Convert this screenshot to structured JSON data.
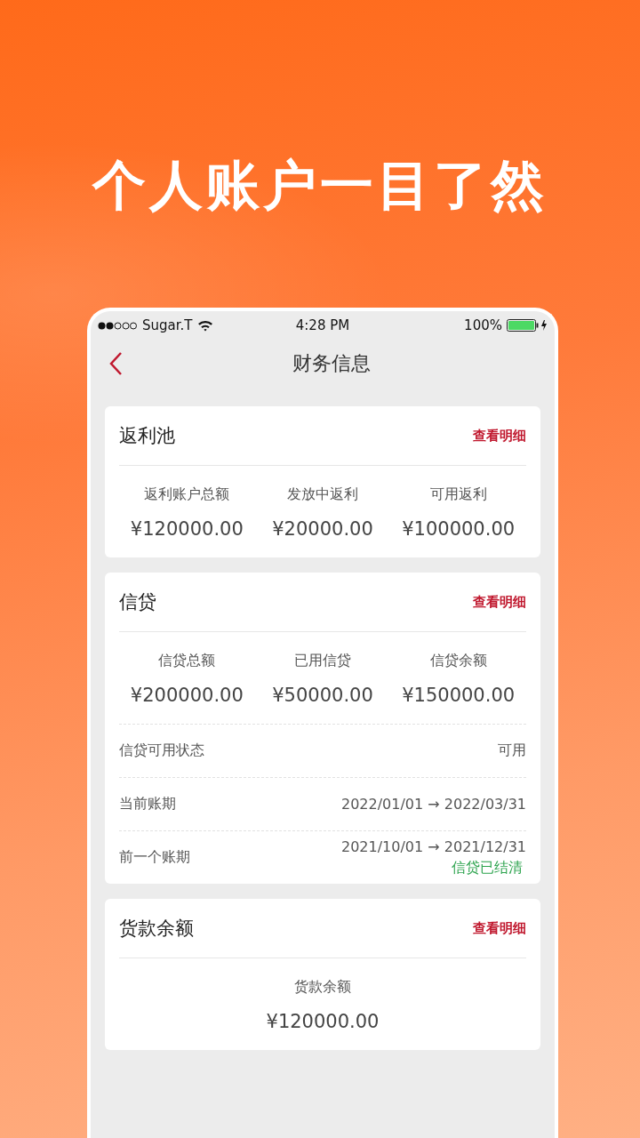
{
  "headline": "个人账户一目了然",
  "status_bar": {
    "carrier": "Sugar.T",
    "time": "4:28 PM",
    "battery": "100%"
  },
  "nav": {
    "title": "财务信息"
  },
  "cards": [
    {
      "title": "返利池",
      "link": "查看明细",
      "stats": [
        {
          "label": "返利账户总额",
          "value": "¥120000.00"
        },
        {
          "label": "发放中返利",
          "value": "¥20000.00"
        },
        {
          "label": "可用返利",
          "value": "¥100000.00"
        }
      ]
    },
    {
      "title": "信贷",
      "link": "查看明细",
      "stats": [
        {
          "label": "信贷总额",
          "value": "¥200000.00"
        },
        {
          "label": "已用信贷",
          "value": "¥50000.00"
        },
        {
          "label": "信贷余额",
          "value": "¥150000.00"
        }
      ],
      "rows": [
        {
          "label": "信贷可用状态",
          "value": "可用"
        },
        {
          "label": "当前账期",
          "value": "2022/01/01 → 2022/03/31"
        },
        {
          "label": "前一个账期",
          "value": "2021/10/01 → 2021/12/31",
          "note": "信贷已结清"
        }
      ]
    },
    {
      "title": "货款余额",
      "link": "查看明细",
      "stats": [
        {
          "label": "货款余额",
          "value": "¥120000.00"
        }
      ]
    }
  ]
}
